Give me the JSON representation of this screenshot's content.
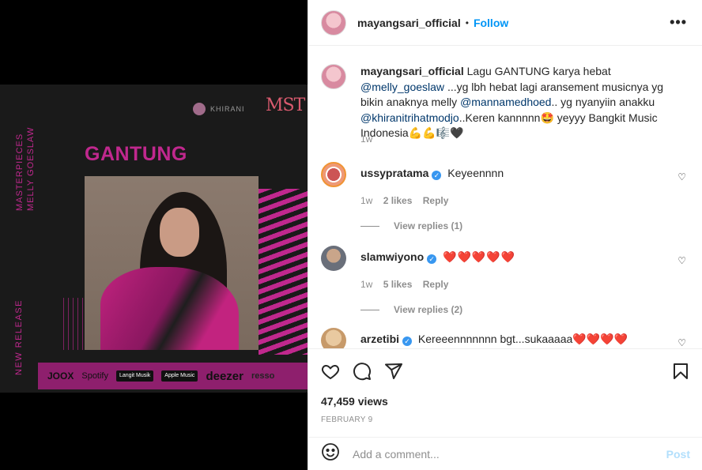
{
  "post": {
    "author": "mayangsari_official",
    "separator": "•",
    "follow_label": "Follow",
    "more_label": "•••"
  },
  "poster": {
    "brand": "KHIRANI",
    "logo": "MST",
    "vertical_1a": "MASTERPIECES",
    "vertical_1b": "MELLY GOESLAW",
    "vertical_2": "NEW RELEASE",
    "title": "GANTUNG",
    "platforms": [
      "JOOX",
      "Spotify",
      "Langit Musik",
      "Apple Music",
      "deezer",
      "resso"
    ]
  },
  "caption": {
    "author": "mayangsari_official",
    "t1": "Lagu GANTUNG karya hebat",
    "m1": "@melly_goeslaw",
    "t2": "...yg lbh hebat lagi aransement musicnya yg bikin anaknya melly",
    "m2": "@mannamedhoed",
    "t3": ".. yg nyanyiin anakku",
    "m3": "@khiranitrihatmodjo",
    "t4": "..Keren kannnnn🤩 yeyyy Bangkit Music Indonesia💪💪🎼🖤",
    "time": "1w"
  },
  "comments": [
    {
      "user": "ussypratama",
      "text": "Keyeennnn",
      "time": "1w",
      "likes": "2 likes",
      "reply": "Reply",
      "view_replies": "View replies (1)"
    },
    {
      "user": "slamwiyono",
      "text": "❤️❤️❤️❤️❤️",
      "time": "1w",
      "likes": "5 likes",
      "reply": "Reply",
      "view_replies": "View replies (2)"
    },
    {
      "user": "arzetibi",
      "text": "Kereeennnnnnn bgt...sukaaaaa❤️❤️❤️❤️"
    }
  ],
  "stats": {
    "views": "47,459 views",
    "date": "FEBRUARY 9"
  },
  "add_comment": {
    "placeholder": "Add a comment...",
    "post_label": "Post"
  },
  "colors": {
    "accent": "#0095f6",
    "brand_magenta": "#c0288e"
  }
}
